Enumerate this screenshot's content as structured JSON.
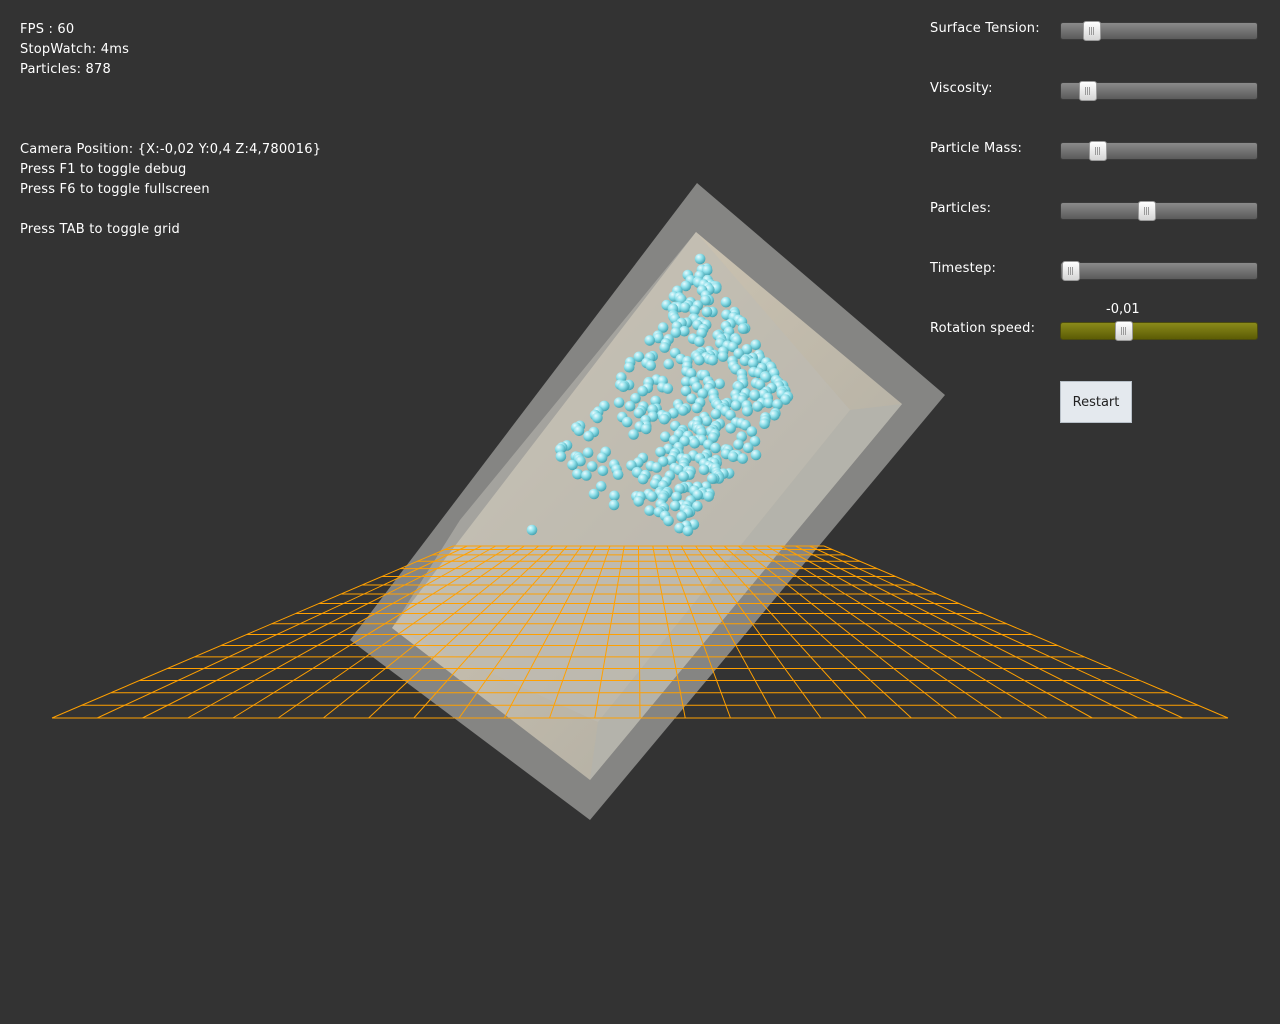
{
  "hud": {
    "fps": "FPS : 60",
    "stopwatch": "StopWatch: 4ms",
    "particles": "Particles: 878",
    "camera": "Camera Position: {X:-0,02 Y:0,4 Z:4,780016}",
    "help_debug": "Press F1 to toggle debug",
    "help_fullscreen": "Press F6 to toggle fullscreen",
    "help_grid": "Press TAB to toggle grid"
  },
  "controls": {
    "surface_tension": {
      "label": "Surface Tension:",
      "value": 0.16
    },
    "viscosity": {
      "label": "Viscosity:",
      "value": 0.14
    },
    "particle_mass": {
      "label": "Particle Mass:",
      "value": 0.19
    },
    "particles": {
      "label": "Particles:",
      "value": 0.44
    },
    "timestep": {
      "label": "Timestep:",
      "value": 0.05
    },
    "rotation_speed": {
      "label": "Rotation speed:",
      "value": 0.32,
      "display": "-0,01"
    }
  },
  "restart_label": "Restart",
  "colors": {
    "background": "#333333",
    "grid": "#ffa000",
    "particle": "#8fe0ea",
    "slider_active": "#7a7a10"
  },
  "scene": {
    "particle_count": 878
  }
}
